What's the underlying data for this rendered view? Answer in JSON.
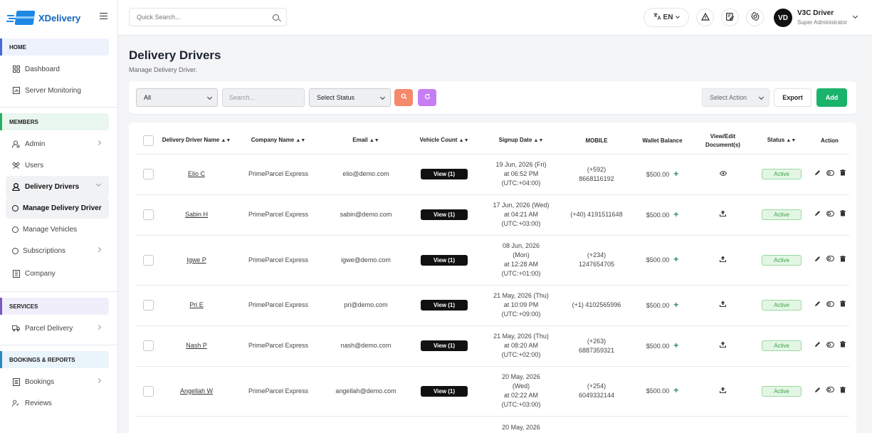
{
  "brand": {
    "name": "XDelivery"
  },
  "sidebar": {
    "sections": {
      "home": "HOME",
      "members": "MEMBERS",
      "services": "SERVICES",
      "bookings": "BOOKINGS & REPORTS"
    },
    "items": {
      "dashboard": "Dashboard",
      "server_monitoring": "Server Monitoring",
      "admin": "Admin",
      "users": "Users",
      "delivery_drivers": "Delivery Drivers",
      "manage_delivery_driver": "Manage Delivery Driver",
      "manage_vehicles": "Manage Vehicles",
      "subscriptions": "Subscriptions",
      "company": "Company",
      "parcel_delivery": "Parcel Delivery",
      "bookings": "Bookings",
      "reviews": "Reviews"
    }
  },
  "topbar": {
    "search_placeholder": "Quick Search...",
    "language": "EN",
    "avatar_initials": "VD",
    "user_name": "V3C Driver",
    "user_role": "Super Administrator"
  },
  "page": {
    "title": "Delivery Drivers",
    "subtitle": "Manage Delivery Driver."
  },
  "filters": {
    "scope": "All",
    "search_placeholder": "Search...",
    "status": "Select Status",
    "action": "Select Action",
    "export": "Export",
    "add": "Add"
  },
  "table": {
    "headers": {
      "name": "Delivery Driver Name",
      "company": "Company Name",
      "email": "Email",
      "vehicle": "Vehicle Count",
      "signup": "Signup Date",
      "mobile": "MOBILE",
      "wallet": "Wallet Balance",
      "docs": "View/Edit Document(s)",
      "status": "Status",
      "action": "Action"
    },
    "sort_glyph": "▲▼",
    "rows": [
      {
        "name": "Elio C",
        "company": "PrimeParcel Express",
        "email": "elio@demo.com",
        "vehicle": "View (1)",
        "signup": [
          "19 Jun, 2026 (Fri)",
          "at 06:52 PM",
          "(UTC:+04:00)"
        ],
        "mobile": [
          "(+592)",
          "8668116192"
        ],
        "wallet": "$500.00",
        "doc_icon": "eye-icon",
        "status": "Active"
      },
      {
        "name": "Sabin H",
        "company": "PrimeParcel Express",
        "email": "sabin@demo.com",
        "vehicle": "View (1)",
        "signup": [
          "17 Jun, 2026 (Wed)",
          "at 04:21 AM",
          "(UTC:+03:00)"
        ],
        "mobile": [
          "(+40) 4191511648"
        ],
        "wallet": "$500.00",
        "doc_icon": "upload-icon",
        "status": "Active"
      },
      {
        "name": "Igwe P",
        "company": "PrimeParcel Express",
        "email": "igwe@demo.com",
        "vehicle": "View (1)",
        "signup": [
          "08 Jun, 2026",
          "(Mon)",
          "at 12:28 AM",
          "(UTC:+01:00)"
        ],
        "mobile": [
          "(+234)",
          "1247654705"
        ],
        "wallet": "$500.00",
        "doc_icon": "upload-icon",
        "status": "Active"
      },
      {
        "name": "Pri E",
        "company": "PrimeParcel Express",
        "email": "pri@demo.com",
        "vehicle": "View (1)",
        "signup": [
          "21 May, 2026 (Thu)",
          "at 10:09 PM",
          "(UTC:+09:00)"
        ],
        "mobile": [
          "(+1) 4102565996"
        ],
        "wallet": "$500.00",
        "doc_icon": "upload-icon",
        "status": "Active"
      },
      {
        "name": "Nash P",
        "company": "PrimeParcel Express",
        "email": "nash@demo.com",
        "vehicle": "View (1)",
        "signup": [
          "21 May, 2026 (Thu)",
          "at 08:20 AM",
          "(UTC:+02:00)"
        ],
        "mobile": [
          "(+263)",
          "6887359321"
        ],
        "wallet": "$500.00",
        "doc_icon": "upload-icon",
        "status": "Active"
      },
      {
        "name": "Angellah W",
        "company": "PrimeParcel Express",
        "email": "angellah@demo.com",
        "vehicle": "View (1)",
        "signup": [
          "20 May, 2026",
          "(Wed)",
          "at 02:22 AM",
          "(UTC:+03:00)"
        ],
        "mobile": [
          "(+254)",
          "6049332144"
        ],
        "wallet": "$500.00",
        "doc_icon": "upload-icon",
        "status": "Active"
      },
      {
        "name": "",
        "company": "",
        "email": "",
        "vehicle": "",
        "signup": [
          "20 May, 2026"
        ],
        "mobile": [],
        "wallet": "",
        "doc_icon": "",
        "status": ""
      }
    ]
  },
  "colors": {
    "add_button": "#19b36b",
    "search_button": "#f4896b",
    "refresh_button": "#c77df3",
    "status_active": "#3aa34b",
    "brand": "#1565c0"
  }
}
